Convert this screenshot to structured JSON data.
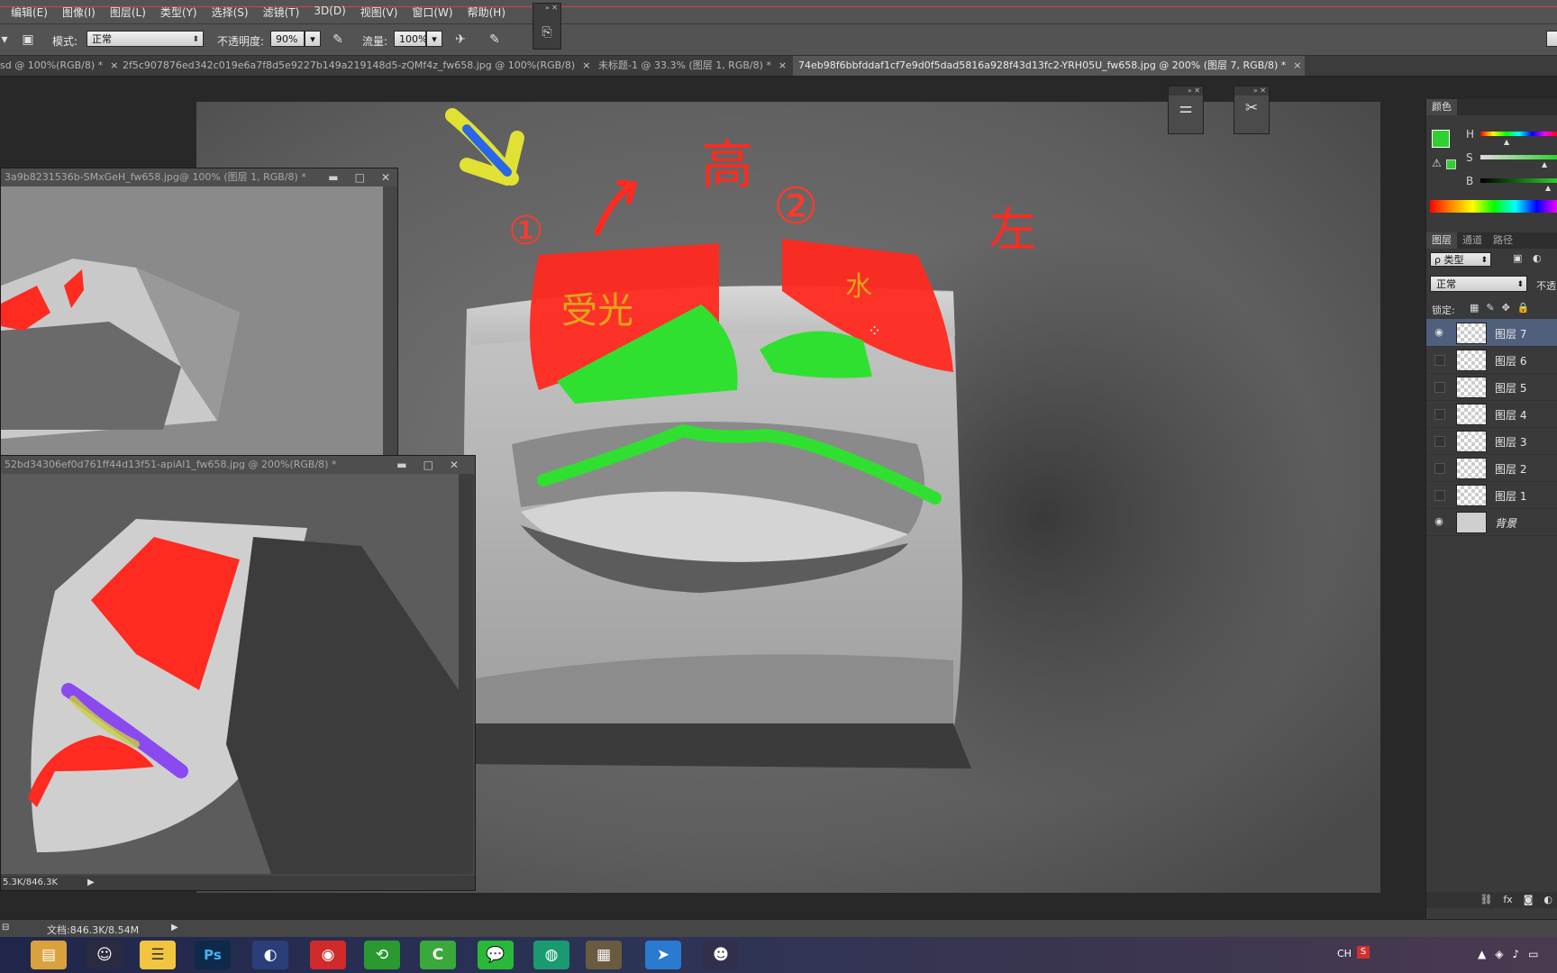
{
  "menu": {
    "items": [
      "编辑(E)",
      "图像(I)",
      "图层(L)",
      "类型(Y)",
      "选择(S)",
      "滤镜(T)",
      "3D(D)",
      "视图(V)",
      "窗口(W)",
      "帮助(H)"
    ]
  },
  "options": {
    "mode_label": "模式:",
    "mode_value": "正常",
    "opacity_label": "不透明度:",
    "opacity_value": "90%",
    "flow_label": "流量:",
    "flow_value": "100%"
  },
  "tabs": [
    {
      "label": "sd @ 100%(RGB/8) *",
      "close": "×"
    },
    {
      "label": "2f5c907876ed342c019e6a7f8d5e9227b149a219148d5-zQMf4z_fw658.jpg @ 100%(RGB/8)",
      "close": "×"
    },
    {
      "label": "未标题-1 @ 33.3% (图层 1, RGB/8) *",
      "close": "×"
    },
    {
      "label": "74eb98f6bbfddaf1cf7e9d0f5dad5816a928f43d13fc2-YRH05U_fw658.jpg @ 200% (图层 7, RGB/8) *",
      "close": "×"
    }
  ],
  "float_windows": {
    "win1": {
      "title": "3a9b8231536b-SMxGeH_fw658.jpg@ 100% (图层 1, RGB/8) *"
    },
    "win2": {
      "title": "52bd34306ef0d761ff44d13f51-apiAl1_fw658.jpg @ 200%(RGB/8) *",
      "status": "5.3K/846.3K"
    }
  },
  "annotations": {
    "num1": "①",
    "num2": "②",
    "top": "高",
    "right": "左",
    "on_red_left": "受光",
    "on_red_right": "水"
  },
  "panel": {
    "color_tab": "颜色",
    "sliders": [
      "H",
      "S",
      "B"
    ],
    "layer_tabs": [
      "图层",
      "通道",
      "路径"
    ],
    "filter_label": "ρ 类型",
    "blend_mode": "正常",
    "opacity_short": "不透",
    "lock_label": "锁定:",
    "layers": [
      {
        "name": "图层 7",
        "visible": true,
        "selected": true
      },
      {
        "name": "图层 6",
        "visible": false,
        "selected": false
      },
      {
        "name": "图层 5",
        "visible": false,
        "selected": false
      },
      {
        "name": "图层 4",
        "visible": false,
        "selected": false
      },
      {
        "name": "图层 3",
        "visible": false,
        "selected": false
      },
      {
        "name": "图层 2",
        "visible": false,
        "selected": false
      },
      {
        "name": "图层 1",
        "visible": false,
        "selected": false
      },
      {
        "name": "背景",
        "visible": true,
        "selected": false
      }
    ],
    "footer_icons": [
      "link-icon",
      "fx-icon",
      "mask-icon",
      "adjustment-icon"
    ]
  },
  "status": {
    "doc": "文档:846.3K/8.54M"
  },
  "taskbar": {
    "tray_text": "CH",
    "apps": [
      "file-explorer-icon",
      "qq-icon",
      "notes-icon",
      "photoshop-icon",
      "browser-icon",
      "netease-music-icon",
      "green-browser-icon",
      "camtasia-icon",
      "wechat-icon",
      "green-app-icon",
      "image-viewer-icon",
      "feishu-icon",
      "qq-penguin-icon"
    ],
    "ps_label": "Ps",
    "c_label": "C"
  },
  "colors": {
    "foreground": "#2fd02f",
    "annotation_red": "#ff2a20",
    "annotation_green": "#2fe02f",
    "selection": "#4f5f7c"
  }
}
